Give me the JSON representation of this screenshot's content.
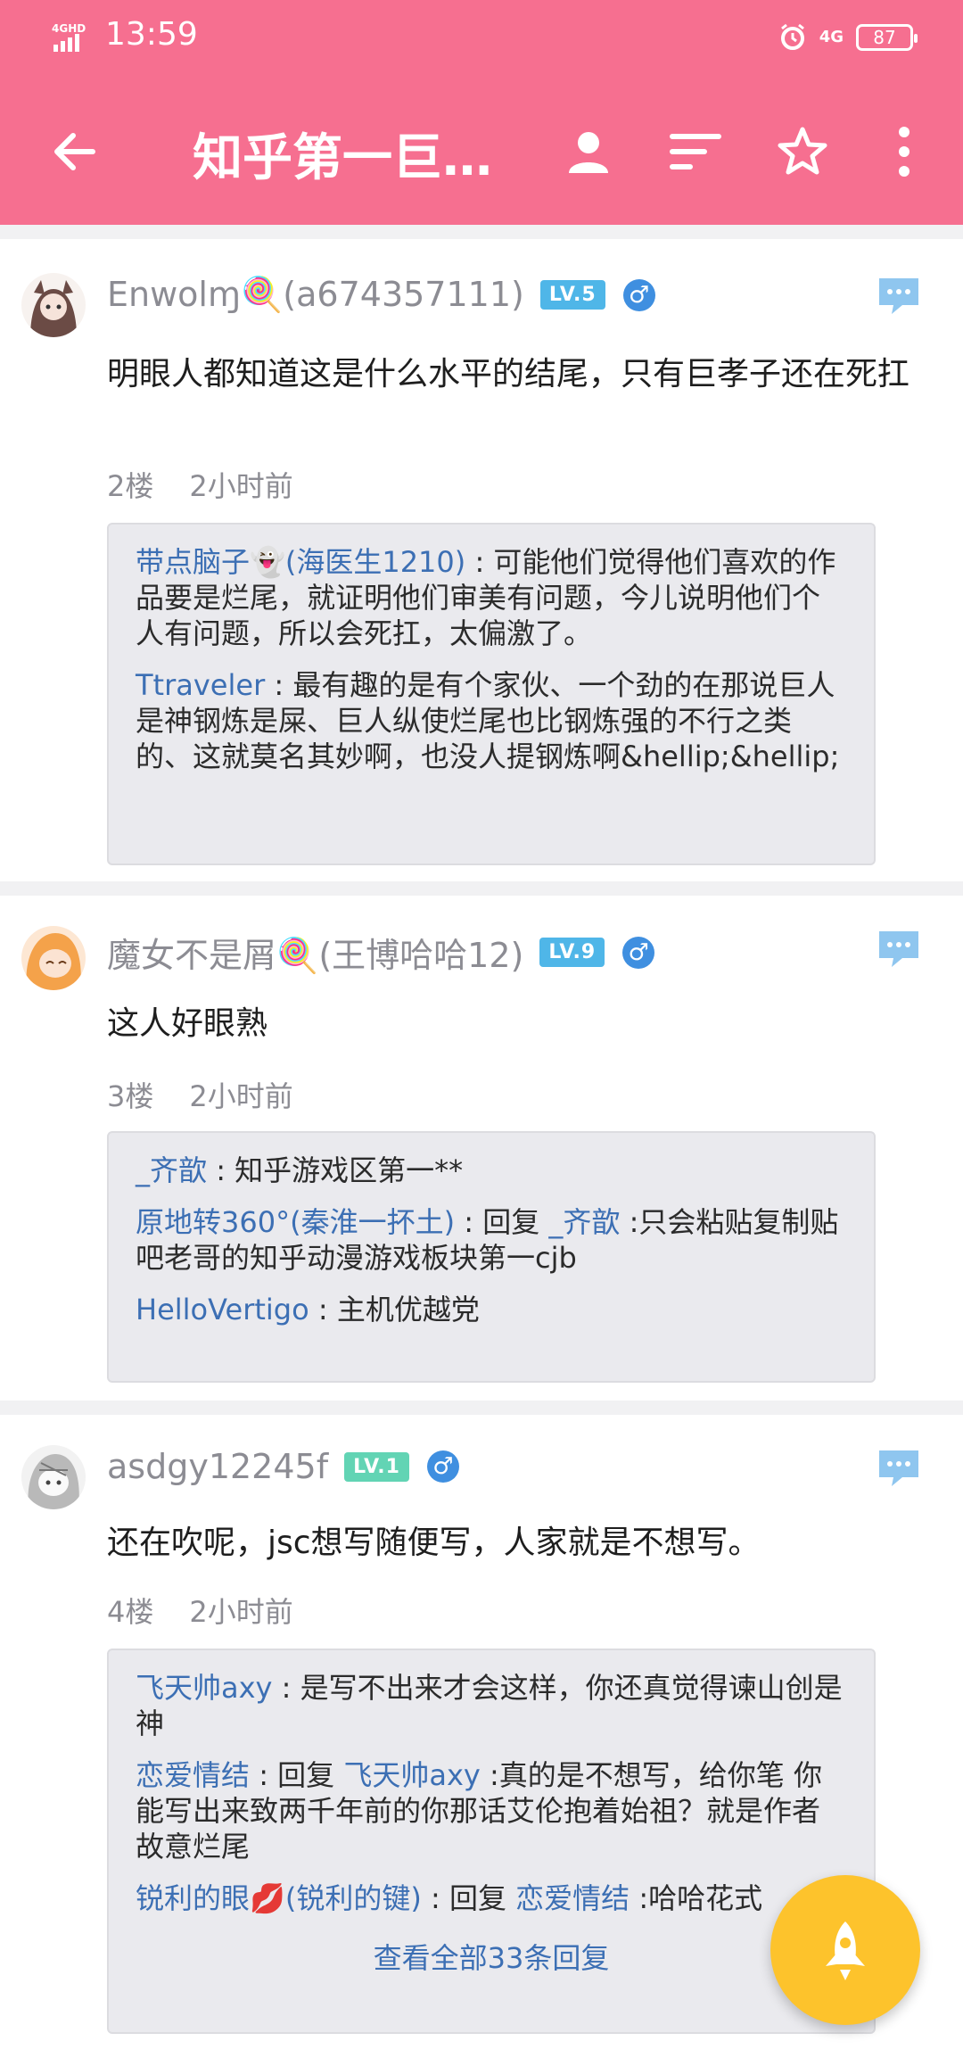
{
  "status_bar": {
    "time": "13:59",
    "network_left": "4G",
    "network_right": "4G",
    "battery": "87"
  },
  "toolbar": {
    "title": "知乎第一巨…"
  },
  "posts": [
    {
      "user": "Enwolɱ🍭(a674357111)",
      "level": "LV.5",
      "level_color": "#4fb6e8",
      "gender": "♂",
      "content": "明眼人都知道这是什么水平的结尾，只有巨孝子还在死扛",
      "floor": "2楼",
      "time": "2小时前",
      "replies": [
        {
          "name": "带点脑子👻(海医生1210)",
          "sep": " : ",
          "text": "可能他们觉得他们喜欢的作品要是烂尾，就证明他们审美有问题，今儿说明他们个人有问题，所以会死扛，太偏激了。"
        },
        {
          "name": "Ttraveler",
          "sep": " : ",
          "text": "最有趣的是有个家伙、一个劲的在那说巨人是神钢炼是屎、巨人纵使烂尾也比钢炼强的不行之类的、这就莫名其妙啊，也没人提钢炼啊&hellip;&hellip;"
        }
      ]
    },
    {
      "user": "魔女不是屑🍭(王博哈哈12)",
      "level": "LV.9",
      "level_color": "#4fb6e8",
      "gender": "♂",
      "content": "这人好眼熟",
      "floor": "3楼",
      "time": "2小时前",
      "replies": [
        {
          "name": "_齐歆",
          "sep": " : ",
          "text": "知乎游戏区第一**"
        },
        {
          "name": "原地转360°(秦淮一抔土)",
          "sep": " : ",
          "pre": "回复 ",
          "target": "_齐歆",
          "text": " :只会粘贴复制贴吧老哥的知乎动漫游戏板块第一cjb"
        },
        {
          "name": "HelloVertigo",
          "sep": " : ",
          "text": "主机优越党"
        }
      ]
    },
    {
      "user": "asdgy12245f",
      "level": "LV.1",
      "level_color": "#62d4b4",
      "gender": "♂",
      "content": "还在吹呢，jsc想写随便写，人家就是不想写。",
      "floor": "4楼",
      "time": "2小时前",
      "replies": [
        {
          "name": "飞天帅axy",
          "sep": " : ",
          "text": "是写不出来才会这样，你还真觉得谏山创是神"
        },
        {
          "name": "恋爱情结",
          "sep": " : ",
          "pre": "回复 ",
          "target": "飞天帅axy",
          "text": " :真的是不想写，给你笔 你能写出来致两千年前的你那话艾伦抱着始祖？就是作者故意烂尾"
        },
        {
          "name": "锐利的眼💋(锐利的键)",
          "sep": " : ",
          "pre": "回复 ",
          "target": "恋爱情结",
          "text": " :哈哈花式"
        }
      ],
      "view_all": "查看全部33条回复"
    }
  ],
  "colors": {
    "header": "#f66f90",
    "link": "#3c6fb4",
    "fab": "#fdc32c"
  },
  "icons": [
    "back-arrow-icon",
    "user-icon",
    "sort-icon",
    "star-icon",
    "more-vertical-icon",
    "comment-bubble-icon",
    "rocket-icon"
  ]
}
